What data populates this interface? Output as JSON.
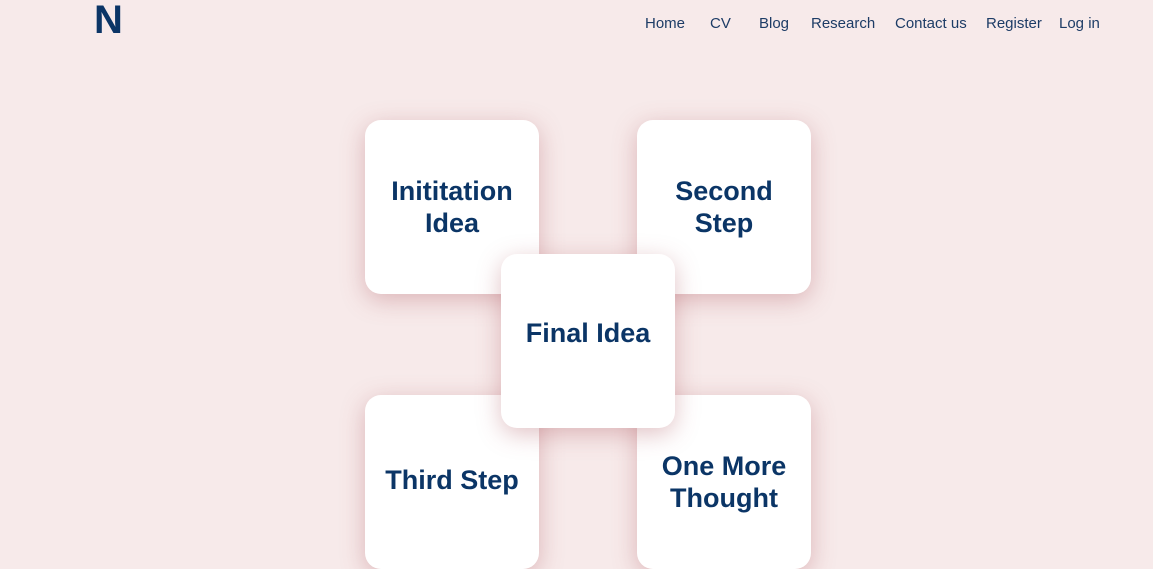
{
  "site": {
    "logo_text": "N"
  },
  "nav": {
    "items": [
      {
        "label": "Home"
      },
      {
        "label": "CV"
      },
      {
        "label": "Blog"
      },
      {
        "label": "Research"
      },
      {
        "label": "Contact us"
      },
      {
        "label": "Register"
      },
      {
        "label": "Log in"
      }
    ]
  },
  "cards": [
    {
      "title": "Inititation Idea"
    },
    {
      "title": "Second Step"
    },
    {
      "title": "Final Idea"
    },
    {
      "title": "Third Step"
    },
    {
      "title": "One More Thought"
    }
  ],
  "colors": {
    "background": "#f7eaea",
    "text": "#0b3566",
    "card": "#ffffff"
  }
}
